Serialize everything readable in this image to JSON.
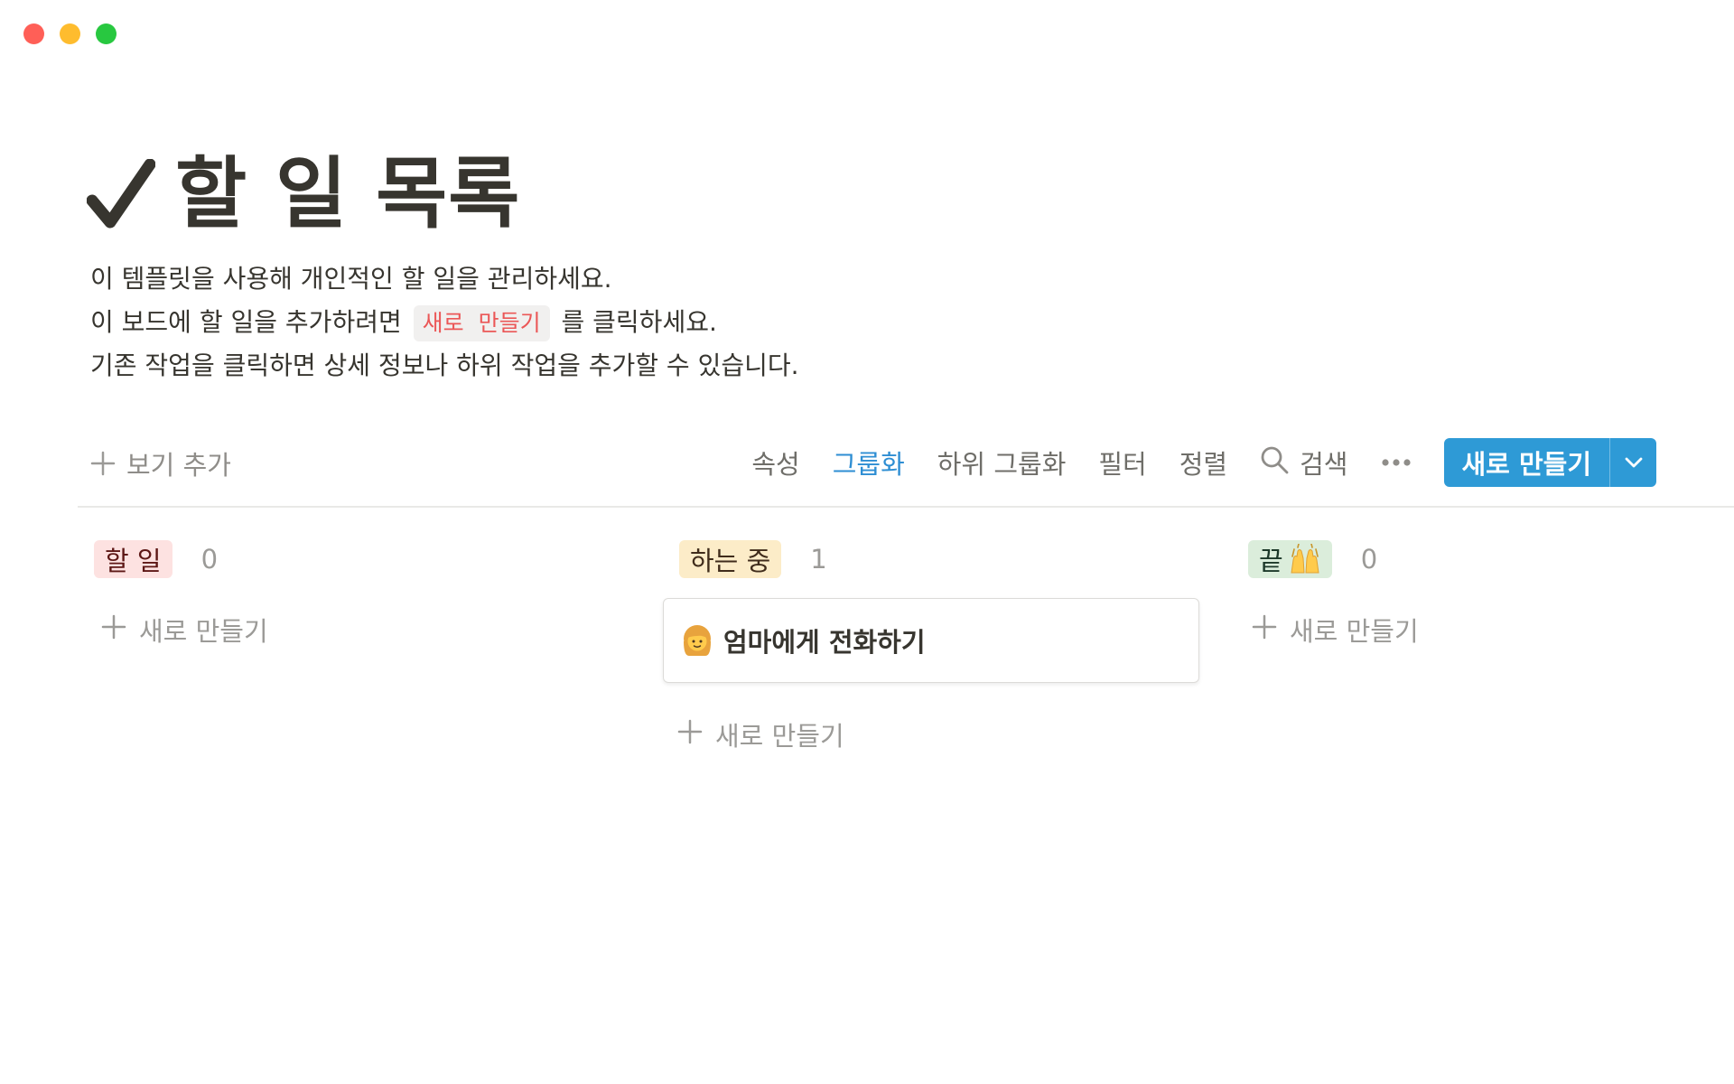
{
  "window": {
    "controls": [
      "close",
      "minimize",
      "maximize"
    ]
  },
  "page": {
    "icon": "checkmark-icon",
    "title": "할 일 목록",
    "description": {
      "line1": "이 템플릿을 사용해 개인적인 할 일을 관리하세요.",
      "line2_before": "이 보드에 할 일을 추가하려면",
      "line2_code": "새로 만들기",
      "line2_after": "를 클릭하세요.",
      "line3": "기존 작업을 클릭하면 상세 정보나 하위 작업을 추가할 수 있습니다."
    }
  },
  "toolbar": {
    "add_view": "보기 추가",
    "properties": "속성",
    "group": "그룹화",
    "subgroup": "하위 그룹화",
    "filter": "필터",
    "sort": "정렬",
    "search": "검색",
    "new_button": "새로 만들기",
    "active_item": "그룹화",
    "accent_color": "#2e9ad6",
    "active_color": "#2e8ed3"
  },
  "board": {
    "columns": [
      {
        "label": "할 일",
        "count": "0",
        "color": "#fde2e1",
        "cards": [],
        "add_label": "새로 만들기"
      },
      {
        "label": "하는 중",
        "count": "1",
        "color": "#fcecc8",
        "cards": [
          {
            "icon": "woman-emoji-icon",
            "title": "엄마에게 전화하기"
          }
        ],
        "add_label": "새로 만들기"
      },
      {
        "label": "끝",
        "label_icon": "raising-hands-emoji-icon",
        "count": "0",
        "color": "#dbeddb",
        "cards": [],
        "add_label": "새로 만들기"
      }
    ]
  }
}
